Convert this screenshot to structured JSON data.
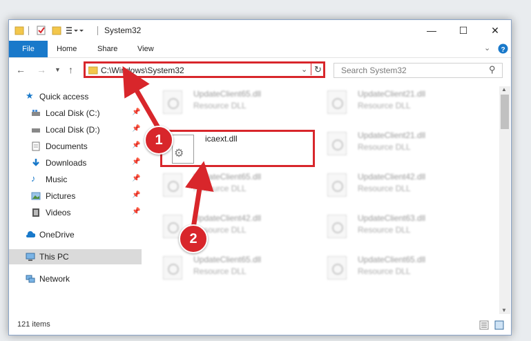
{
  "window": {
    "title": "System32"
  },
  "ribbon": {
    "tabs": [
      "File",
      "Home",
      "Share",
      "View"
    ]
  },
  "address": {
    "path": "C:\\Windows\\System32"
  },
  "search": {
    "placeholder": "Search System32"
  },
  "sidebar": {
    "items": [
      {
        "label": "Quick access",
        "icon": "star-icon",
        "pinned": false
      },
      {
        "label": "Local Disk (C:)",
        "icon": "drive-icon",
        "pinned": true
      },
      {
        "label": "Local Disk (D:)",
        "icon": "drive-icon",
        "pinned": true
      },
      {
        "label": "Documents",
        "icon": "documents-icon",
        "pinned": true
      },
      {
        "label": "Downloads",
        "icon": "download-icon",
        "pinned": true
      },
      {
        "label": "Music",
        "icon": "music-icon",
        "pinned": true
      },
      {
        "label": "Pictures",
        "icon": "pictures-icon",
        "pinned": true
      },
      {
        "label": "Videos",
        "icon": "videos-icon",
        "pinned": true
      },
      {
        "label": "OneDrive",
        "icon": "cloud-icon",
        "pinned": false
      },
      {
        "label": "This PC",
        "icon": "computer-icon",
        "pinned": false,
        "selected": true
      },
      {
        "label": "Network",
        "icon": "network-icon",
        "pinned": false
      }
    ]
  },
  "files": {
    "highlighted": {
      "name": "icaext.dll"
    },
    "blurred": [
      {
        "name": "UpdateClient65.dll",
        "type": "Resource DLL"
      },
      {
        "name": "UpdateClient21.dll",
        "type": "Resource DLL"
      },
      {
        "name": "UpdateClient21.dll",
        "type": "Resource DLL"
      },
      {
        "name": "UpdateClient65.dll",
        "type": "Resource DLL"
      },
      {
        "name": "UpdateClient42.dll",
        "type": "Resource DLL"
      },
      {
        "name": "UpdateClient42.dll",
        "type": "Resource DLL"
      },
      {
        "name": "UpdateClient63.dll",
        "type": "Resource DLL"
      },
      {
        "name": "UpdateClient65.dll",
        "type": "Resource DLL"
      },
      {
        "name": "UpdateClient65.dll",
        "type": "Resource DLL"
      }
    ]
  },
  "status": {
    "count": "121 items"
  },
  "annotations": {
    "step1": "1",
    "step2": "2"
  },
  "colors": {
    "accent": "#1979ca",
    "highlight": "#d8262b"
  }
}
